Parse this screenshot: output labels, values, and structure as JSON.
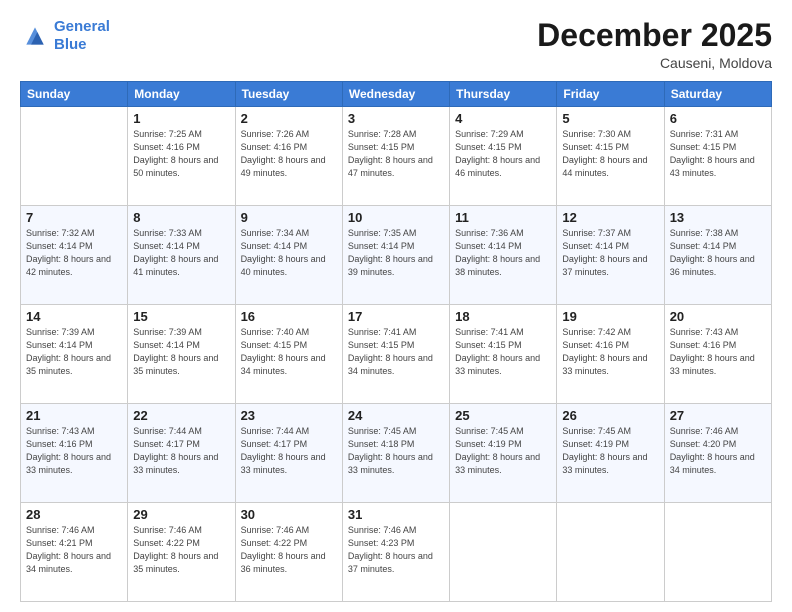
{
  "header": {
    "logo_line1": "General",
    "logo_line2": "Blue",
    "title": "December 2025",
    "subtitle": "Causeni, Moldova"
  },
  "weekdays": [
    "Sunday",
    "Monday",
    "Tuesday",
    "Wednesday",
    "Thursday",
    "Friday",
    "Saturday"
  ],
  "weeks": [
    [
      {
        "day": "",
        "sunrise": "",
        "sunset": "",
        "daylight": ""
      },
      {
        "day": "1",
        "sunrise": "Sunrise: 7:25 AM",
        "sunset": "Sunset: 4:16 PM",
        "daylight": "Daylight: 8 hours and 50 minutes."
      },
      {
        "day": "2",
        "sunrise": "Sunrise: 7:26 AM",
        "sunset": "Sunset: 4:16 PM",
        "daylight": "Daylight: 8 hours and 49 minutes."
      },
      {
        "day": "3",
        "sunrise": "Sunrise: 7:28 AM",
        "sunset": "Sunset: 4:15 PM",
        "daylight": "Daylight: 8 hours and 47 minutes."
      },
      {
        "day": "4",
        "sunrise": "Sunrise: 7:29 AM",
        "sunset": "Sunset: 4:15 PM",
        "daylight": "Daylight: 8 hours and 46 minutes."
      },
      {
        "day": "5",
        "sunrise": "Sunrise: 7:30 AM",
        "sunset": "Sunset: 4:15 PM",
        "daylight": "Daylight: 8 hours and 44 minutes."
      },
      {
        "day": "6",
        "sunrise": "Sunrise: 7:31 AM",
        "sunset": "Sunset: 4:15 PM",
        "daylight": "Daylight: 8 hours and 43 minutes."
      }
    ],
    [
      {
        "day": "7",
        "sunrise": "Sunrise: 7:32 AM",
        "sunset": "Sunset: 4:14 PM",
        "daylight": "Daylight: 8 hours and 42 minutes."
      },
      {
        "day": "8",
        "sunrise": "Sunrise: 7:33 AM",
        "sunset": "Sunset: 4:14 PM",
        "daylight": "Daylight: 8 hours and 41 minutes."
      },
      {
        "day": "9",
        "sunrise": "Sunrise: 7:34 AM",
        "sunset": "Sunset: 4:14 PM",
        "daylight": "Daylight: 8 hours and 40 minutes."
      },
      {
        "day": "10",
        "sunrise": "Sunrise: 7:35 AM",
        "sunset": "Sunset: 4:14 PM",
        "daylight": "Daylight: 8 hours and 39 minutes."
      },
      {
        "day": "11",
        "sunrise": "Sunrise: 7:36 AM",
        "sunset": "Sunset: 4:14 PM",
        "daylight": "Daylight: 8 hours and 38 minutes."
      },
      {
        "day": "12",
        "sunrise": "Sunrise: 7:37 AM",
        "sunset": "Sunset: 4:14 PM",
        "daylight": "Daylight: 8 hours and 37 minutes."
      },
      {
        "day": "13",
        "sunrise": "Sunrise: 7:38 AM",
        "sunset": "Sunset: 4:14 PM",
        "daylight": "Daylight: 8 hours and 36 minutes."
      }
    ],
    [
      {
        "day": "14",
        "sunrise": "Sunrise: 7:39 AM",
        "sunset": "Sunset: 4:14 PM",
        "daylight": "Daylight: 8 hours and 35 minutes."
      },
      {
        "day": "15",
        "sunrise": "Sunrise: 7:39 AM",
        "sunset": "Sunset: 4:14 PM",
        "daylight": "Daylight: 8 hours and 35 minutes."
      },
      {
        "day": "16",
        "sunrise": "Sunrise: 7:40 AM",
        "sunset": "Sunset: 4:15 PM",
        "daylight": "Daylight: 8 hours and 34 minutes."
      },
      {
        "day": "17",
        "sunrise": "Sunrise: 7:41 AM",
        "sunset": "Sunset: 4:15 PM",
        "daylight": "Daylight: 8 hours and 34 minutes."
      },
      {
        "day": "18",
        "sunrise": "Sunrise: 7:41 AM",
        "sunset": "Sunset: 4:15 PM",
        "daylight": "Daylight: 8 hours and 33 minutes."
      },
      {
        "day": "19",
        "sunrise": "Sunrise: 7:42 AM",
        "sunset": "Sunset: 4:16 PM",
        "daylight": "Daylight: 8 hours and 33 minutes."
      },
      {
        "day": "20",
        "sunrise": "Sunrise: 7:43 AM",
        "sunset": "Sunset: 4:16 PM",
        "daylight": "Daylight: 8 hours and 33 minutes."
      }
    ],
    [
      {
        "day": "21",
        "sunrise": "Sunrise: 7:43 AM",
        "sunset": "Sunset: 4:16 PM",
        "daylight": "Daylight: 8 hours and 33 minutes."
      },
      {
        "day": "22",
        "sunrise": "Sunrise: 7:44 AM",
        "sunset": "Sunset: 4:17 PM",
        "daylight": "Daylight: 8 hours and 33 minutes."
      },
      {
        "day": "23",
        "sunrise": "Sunrise: 7:44 AM",
        "sunset": "Sunset: 4:17 PM",
        "daylight": "Daylight: 8 hours and 33 minutes."
      },
      {
        "day": "24",
        "sunrise": "Sunrise: 7:45 AM",
        "sunset": "Sunset: 4:18 PM",
        "daylight": "Daylight: 8 hours and 33 minutes."
      },
      {
        "day": "25",
        "sunrise": "Sunrise: 7:45 AM",
        "sunset": "Sunset: 4:19 PM",
        "daylight": "Daylight: 8 hours and 33 minutes."
      },
      {
        "day": "26",
        "sunrise": "Sunrise: 7:45 AM",
        "sunset": "Sunset: 4:19 PM",
        "daylight": "Daylight: 8 hours and 33 minutes."
      },
      {
        "day": "27",
        "sunrise": "Sunrise: 7:46 AM",
        "sunset": "Sunset: 4:20 PM",
        "daylight": "Daylight: 8 hours and 34 minutes."
      }
    ],
    [
      {
        "day": "28",
        "sunrise": "Sunrise: 7:46 AM",
        "sunset": "Sunset: 4:21 PM",
        "daylight": "Daylight: 8 hours and 34 minutes."
      },
      {
        "day": "29",
        "sunrise": "Sunrise: 7:46 AM",
        "sunset": "Sunset: 4:22 PM",
        "daylight": "Daylight: 8 hours and 35 minutes."
      },
      {
        "day": "30",
        "sunrise": "Sunrise: 7:46 AM",
        "sunset": "Sunset: 4:22 PM",
        "daylight": "Daylight: 8 hours and 36 minutes."
      },
      {
        "day": "31",
        "sunrise": "Sunrise: 7:46 AM",
        "sunset": "Sunset: 4:23 PM",
        "daylight": "Daylight: 8 hours and 37 minutes."
      },
      {
        "day": "",
        "sunrise": "",
        "sunset": "",
        "daylight": ""
      },
      {
        "day": "",
        "sunrise": "",
        "sunset": "",
        "daylight": ""
      },
      {
        "day": "",
        "sunrise": "",
        "sunset": "",
        "daylight": ""
      }
    ]
  ]
}
